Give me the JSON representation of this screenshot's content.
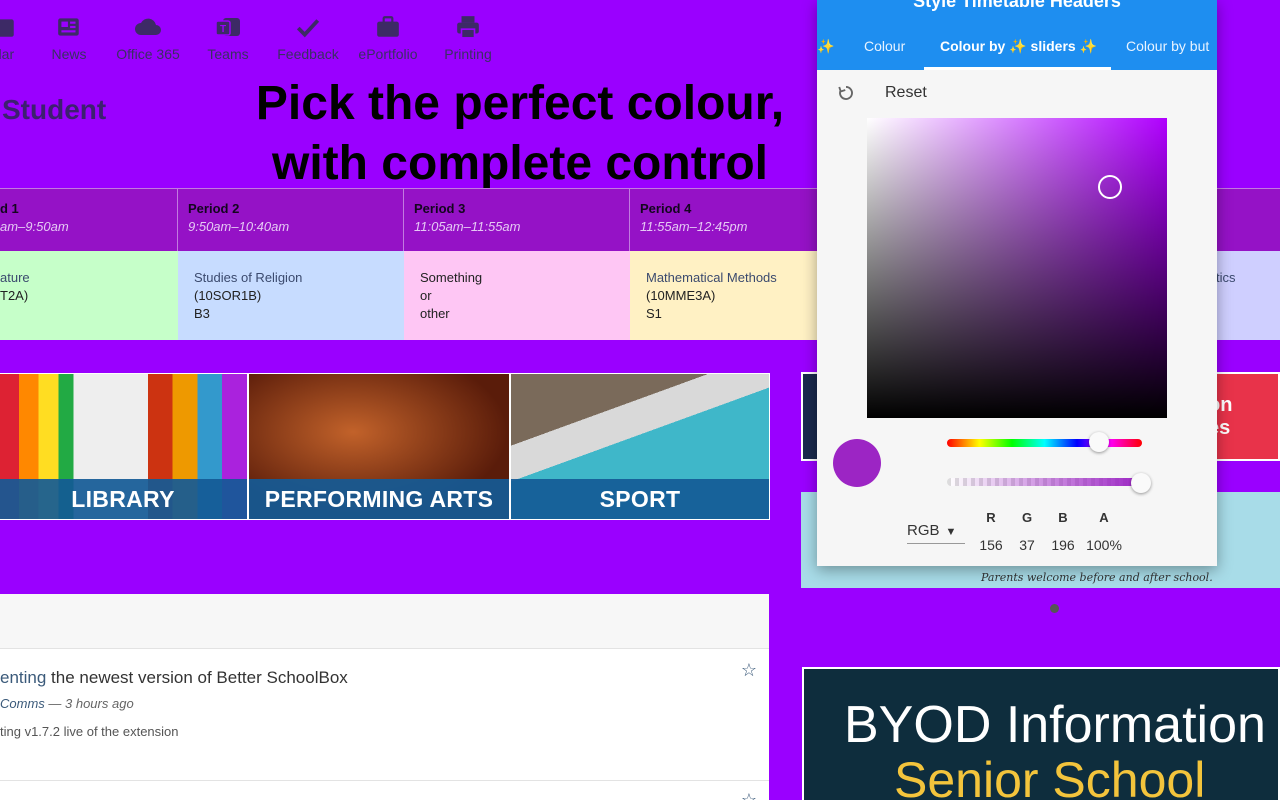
{
  "nav": [
    {
      "label": "dar",
      "icon": "calendar-icon"
    },
    {
      "label": "News",
      "icon": "news-icon"
    },
    {
      "label": "Office 365",
      "icon": "cloud-icon"
    },
    {
      "label": "Teams",
      "icon": "teams-icon"
    },
    {
      "label": "Feedback",
      "icon": "check-icon"
    },
    {
      "label": "ePortfolio",
      "icon": "briefcase-icon"
    },
    {
      "label": "Printing",
      "icon": "printer-icon"
    }
  ],
  "student_heading": "Student",
  "headline": {
    "line1": "Pick the perfect colour,",
    "line2": "with complete control"
  },
  "timetable": {
    "periods": [
      {
        "label": "d 1",
        "time": "am–9:50am"
      },
      {
        "label": "Period 2",
        "time": "9:50am–10:40am"
      },
      {
        "label": "Period 3",
        "time": "11:05am–11:55am"
      },
      {
        "label": "Period 4",
        "time": "11:55am–12:45pm"
      }
    ],
    "classes": [
      {
        "l1": "ature",
        "l2": "T2A)",
        "l3": "",
        "color": "#c6ffc9"
      },
      {
        "l1": "Studies of Religion",
        "l2": "(10SOR1B)",
        "l3": "B3",
        "color": "#c7dcff"
      },
      {
        "l1": "Something",
        "l2": "or",
        "l3": "other",
        "color": "#fec6f4"
      },
      {
        "l1": "Mathematical Methods",
        "l2": "(10MME3A)",
        "l3": "S1",
        "color": "#fff1c4"
      },
      {
        "l1": "tics",
        "l2": "",
        "l3": "",
        "color": "#cfcfff"
      }
    ]
  },
  "tiles": [
    {
      "label": "LIBRARY"
    },
    {
      "label": "PERFORMING ARTS"
    },
    {
      "label": "SPORT"
    }
  ],
  "news": {
    "title_link": "enting",
    "title_rest": " the newest version of Better SchoolBox",
    "author": "Comms",
    "time": " — 3 hours ago",
    "body": "ting v1.7.2 live of the extension"
  },
  "right": {
    "banner1_text_l1": "on",
    "banner1_text_l2": "es",
    "banner2_caption": "Parents welcome before and after school.",
    "byod_l1": "BYOD Information",
    "byod_l2": "Senior School"
  },
  "panel": {
    "title": "Style Timetable Headers",
    "tabs": [
      "✨",
      "Colour",
      "Colour by ✨ sliders ✨",
      "Colour by but"
    ],
    "active_tab": 2,
    "reset_label": "Reset",
    "mode": "RGB",
    "channels": [
      {
        "name": "R",
        "value": "156"
      },
      {
        "name": "G",
        "value": "37"
      },
      {
        "name": "B",
        "value": "196"
      },
      {
        "name": "A",
        "value": "100%"
      }
    ],
    "current_color": "#9c25c4",
    "hue_fraction": 0.79,
    "alpha_fraction": 1.0
  },
  "colors": {
    "page_bg": "#9a00ff",
    "panel_header": "#1e8ef0",
    "header_cells": "#9512c6"
  }
}
